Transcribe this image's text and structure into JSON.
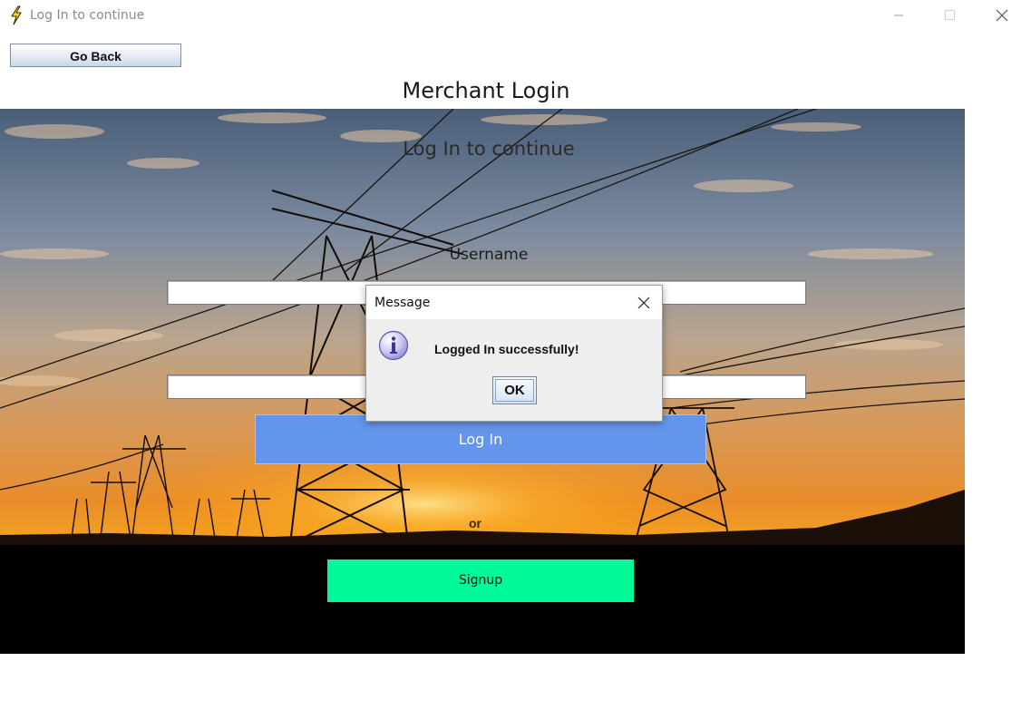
{
  "window": {
    "title": "Log In to continue",
    "icon": "lightning-bolt-icon"
  },
  "header": {
    "back_label": "Go Back",
    "page_title": "Merchant Login"
  },
  "form": {
    "subtitle": "Log In to continue",
    "username_label": "Username",
    "username_value": "",
    "password_value": "",
    "login_label": "Log In",
    "or_label": "or",
    "signup_label": "Signup"
  },
  "dialog": {
    "title": "Message",
    "icon": "info-icon",
    "message": "Logged In successfully!",
    "ok_label": "OK"
  },
  "colors": {
    "login_button": "#6495ED",
    "signup_button": "#00FA9A",
    "dialog_background": "#EEEEEE"
  }
}
